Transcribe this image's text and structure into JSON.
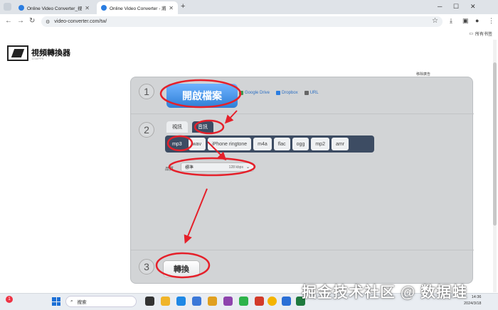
{
  "browser": {
    "tabs": [
      {
        "title": "Online Video Converter_视頻..."
      },
      {
        "title": "Online Video Converter - 將..."
      }
    ],
    "url": "video-converter.com/tw/",
    "bookmarks_label": "所有书签"
  },
  "site": {
    "brand": "視頻轉換器",
    "brand_sub": "123APPS",
    "ad_label": "移除廣告"
  },
  "step1": {
    "number": "1",
    "open_button": "開啟檔案",
    "sources": [
      {
        "label": "Google Drive",
        "icon": "google-drive-icon",
        "color": "#3c9b4f"
      },
      {
        "label": "Dropbox",
        "icon": "dropbox-icon",
        "color": "#2a7de1"
      },
      {
        "label": "URL",
        "icon": "link-icon",
        "color": "#666666"
      }
    ]
  },
  "step2": {
    "number": "2",
    "media_tabs": [
      "視訊",
      "音訊"
    ],
    "active_media_tab": "音訊",
    "formats": [
      "mp3",
      "wav",
      "iPhone ringtone",
      "m4a",
      "flac",
      "ogg",
      "mp2",
      "amr"
    ],
    "active_format": "mp3",
    "quality_label": "品質",
    "quality_value": "標準",
    "quality_bitrate": "128 kbps"
  },
  "step3": {
    "number": "3",
    "convert_button": "轉換"
  },
  "taskbar": {
    "search_placeholder": "搜索",
    "notification_count": "1",
    "time": "14:36",
    "date": "2024/3/18"
  },
  "watermark": "掘金技术社区 @ 数据蛙",
  "colors": {
    "accent_blue": "#2f7fd6",
    "dark_tab": "#3d4c63",
    "annotation_red": "#e5202a"
  }
}
